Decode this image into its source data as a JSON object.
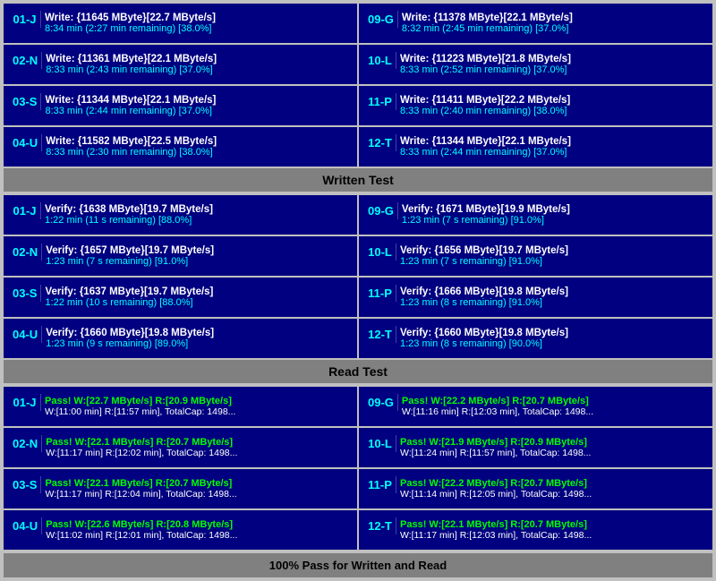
{
  "sections": {
    "write_test": {
      "label": "Written Test",
      "rows": [
        {
          "left": {
            "id": "01-J",
            "line1": "Write: {11645 MByte}[22.7 MByte/s]",
            "line2": "8:34 min (2:27 min remaining)  [38.0%]"
          },
          "right": {
            "id": "09-G",
            "line1": "Write: {11378 MByte}[22.1 MByte/s]",
            "line2": "8:32 min (2:45 min remaining)  [37.0%]"
          }
        },
        {
          "left": {
            "id": "02-N",
            "line1": "Write: {11361 MByte}[22.1 MByte/s]",
            "line2": "8:33 min (2:43 min remaining)  [37.0%]"
          },
          "right": {
            "id": "10-L",
            "line1": "Write: {11223 MByte}[21.8 MByte/s]",
            "line2": "8:33 min (2:52 min remaining)  [37.0%]"
          }
        },
        {
          "left": {
            "id": "03-S",
            "line1": "Write: {11344 MByte}[22.1 MByte/s]",
            "line2": "8:33 min (2:44 min remaining)  [37.0%]"
          },
          "right": {
            "id": "11-P",
            "line1": "Write: {11411 MByte}[22.2 MByte/s]",
            "line2": "8:33 min (2:40 min remaining)  [38.0%]"
          }
        },
        {
          "left": {
            "id": "04-U",
            "line1": "Write: {11582 MByte}[22.5 MByte/s]",
            "line2": "8:33 min (2:30 min remaining)  [38.0%]"
          },
          "right": {
            "id": "12-T",
            "line1": "Write: {11344 MByte}[22.1 MByte/s]",
            "line2": "8:33 min (2:44 min remaining)  [37.0%]"
          }
        }
      ]
    },
    "verify_test": {
      "rows": [
        {
          "left": {
            "id": "01-J",
            "line1": "Verify: {1638 MByte}[19.7 MByte/s]",
            "line2": "1:22 min (11 s remaining)   [88.0%]"
          },
          "right": {
            "id": "09-G",
            "line1": "Verify: {1671 MByte}[19.9 MByte/s]",
            "line2": "1:23 min (7 s remaining)   [91.0%]"
          }
        },
        {
          "left": {
            "id": "02-N",
            "line1": "Verify: {1657 MByte}[19.7 MByte/s]",
            "line2": "1:23 min (7 s remaining)   [91.0%]"
          },
          "right": {
            "id": "10-L",
            "line1": "Verify: {1656 MByte}[19.7 MByte/s]",
            "line2": "1:23 min (7 s remaining)   [91.0%]"
          }
        },
        {
          "left": {
            "id": "03-S",
            "line1": "Verify: {1637 MByte}[19.7 MByte/s]",
            "line2": "1:22 min (10 s remaining)   [88.0%]"
          },
          "right": {
            "id": "11-P",
            "line1": "Verify: {1666 MByte}[19.8 MByte/s]",
            "line2": "1:23 min (8 s remaining)   [91.0%]"
          }
        },
        {
          "left": {
            "id": "04-U",
            "line1": "Verify: {1660 MByte}[19.8 MByte/s]",
            "line2": "1:23 min (9 s remaining)   [89.0%]"
          },
          "right": {
            "id": "12-T",
            "line1": "Verify: {1660 MByte}[19.8 MByte/s]",
            "line2": "1:23 min (8 s remaining)   [90.0%]"
          }
        }
      ]
    },
    "read_test": {
      "label": "Read Test",
      "rows": [
        {
          "left": {
            "id": "01-J",
            "pass_line1": "Pass! W:[22.7 MByte/s] R:[20.9 MByte/s]",
            "pass_line2": " W:[11:00 min] R:[11:57 min], TotalCap: 1498..."
          },
          "right": {
            "id": "09-G",
            "pass_line1": "Pass! W:[22.2 MByte/s] R:[20.7 MByte/s]",
            "pass_line2": " W:[11:16 min] R:[12:03 min], TotalCap: 1498..."
          }
        },
        {
          "left": {
            "id": "02-N",
            "pass_line1": "Pass! W:[22.1 MByte/s] R:[20.7 MByte/s]",
            "pass_line2": " W:[11:17 min] R:[12:02 min], TotalCap: 1498..."
          },
          "right": {
            "id": "10-L",
            "pass_line1": "Pass! W:[21.9 MByte/s] R:[20.9 MByte/s]",
            "pass_line2": " W:[11:24 min] R:[11:57 min], TotalCap: 1498..."
          }
        },
        {
          "left": {
            "id": "03-S",
            "pass_line1": "Pass! W:[22.1 MByte/s] R:[20.7 MByte/s]",
            "pass_line2": " W:[11:17 min] R:[12:04 min], TotalCap: 1498..."
          },
          "right": {
            "id": "11-P",
            "pass_line1": "Pass! W:[22.2 MByte/s] R:[20.7 MByte/s]",
            "pass_line2": " W:[11:14 min] R:[12:05 min], TotalCap: 1498..."
          }
        },
        {
          "left": {
            "id": "04-U",
            "pass_line1": "Pass! W:[22.6 MByte/s] R:[20.8 MByte/s]",
            "pass_line2": " W:[11:02 min] R:[12:01 min], TotalCap: 1498..."
          },
          "right": {
            "id": "12-T",
            "pass_line1": "Pass! W:[22.1 MByte/s] R:[20.7 MByte/s]",
            "pass_line2": " W:[11:17 min] R:[12:03 min], TotalCap: 1498..."
          }
        }
      ]
    }
  },
  "labels": {
    "written_test": "Written Test",
    "read_test": "Read Test",
    "footer": "100% Pass for Written and Read"
  }
}
